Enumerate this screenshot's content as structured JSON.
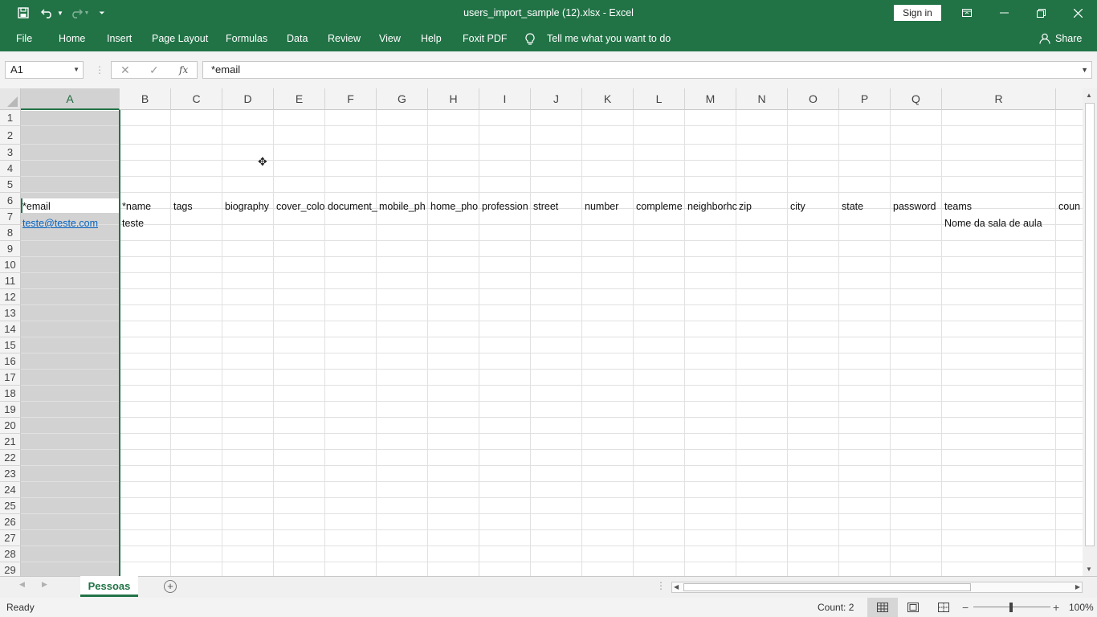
{
  "window": {
    "title": "users_import_sample (12).xlsx  -  Excel",
    "sign_in": "Sign in"
  },
  "ribbon": {
    "tabs": [
      "File",
      "Home",
      "Insert",
      "Page Layout",
      "Formulas",
      "Data",
      "Review",
      "View",
      "Help",
      "Foxit PDF"
    ],
    "tell_me": "Tell me what you want to do",
    "share": "Share"
  },
  "formula_bar": {
    "name_box": "A1",
    "content": "*email"
  },
  "sheet": {
    "columns": [
      "A",
      "B",
      "C",
      "D",
      "E",
      "F",
      "G",
      "H",
      "I",
      "J",
      "K",
      "L",
      "M",
      "N",
      "O",
      "P",
      "Q",
      "R"
    ],
    "rows": [
      "1",
      "2",
      "3",
      "4",
      "5",
      "6",
      "7",
      "8",
      "9",
      "10",
      "11",
      "12",
      "13",
      "14",
      "15",
      "16",
      "17",
      "18",
      "19",
      "20",
      "21",
      "22",
      "23",
      "24",
      "25",
      "26",
      "27",
      "28",
      "29"
    ],
    "header_row": [
      "*email",
      "*name",
      "tags",
      "biography",
      "cover_colo",
      "document_",
      "mobile_ph",
      "home_pho",
      "profession",
      "street",
      "number",
      "compleme",
      "neighborhc",
      "zip",
      "city",
      "state",
      "password",
      "teams",
      "coun"
    ],
    "data_row": {
      "A": "teste@teste.com",
      "B": "teste",
      "R": "Nome da sala de aula"
    }
  },
  "sheet_tabs": [
    "Pessoas"
  ],
  "status": {
    "mode": "Ready",
    "count": "Count: 2",
    "zoom": "100%"
  }
}
